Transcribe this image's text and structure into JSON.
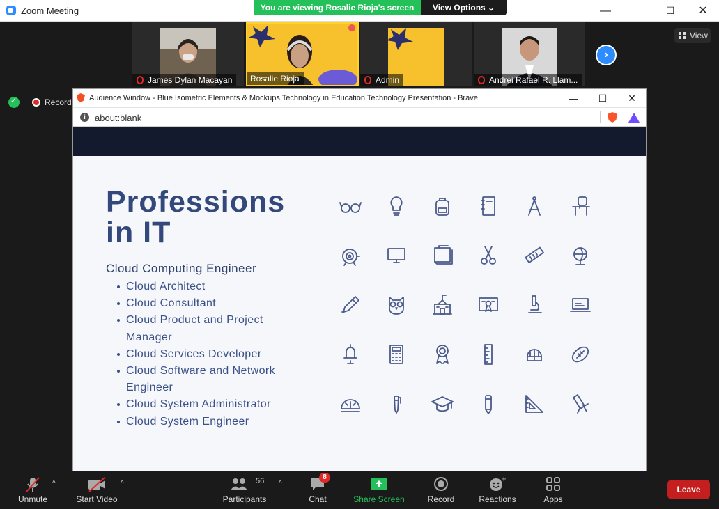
{
  "window": {
    "title": "Zoom Meeting",
    "minimize": "—",
    "maximize": "☐",
    "close": "✕"
  },
  "banner": {
    "message": "You are viewing Rosalie Rioja's screen",
    "view_options": "View Options ⌄"
  },
  "participants_strip": [
    {
      "name": "James Dylan Macayan",
      "muted": true
    },
    {
      "name": "Rosalie Rioja",
      "muted": false
    },
    {
      "name": "Admin",
      "muted": true
    },
    {
      "name": "Andrei Rafael R. Llam...",
      "muted": true
    }
  ],
  "view_button": "View",
  "recording_label": "Recording",
  "browser": {
    "title": "Audience Window - Blue Isometric Elements & Mockups Technology in Education Technology Presentation - Brave",
    "address": "about:blank",
    "info_glyph": "i",
    "minimize": "—",
    "maximize": "☐",
    "close": "✕"
  },
  "slide": {
    "title_line1": "Professions",
    "title_line2": "in IT",
    "subheading": "Cloud Computing Engineer",
    "items": [
      "Cloud Architect",
      "Cloud Consultant",
      "Cloud Product and Project Manager",
      "Cloud Services Developer",
      "Cloud Software and Network Engineer",
      "Cloud System Administrator",
      "Cloud System Engineer"
    ],
    "icon_color": "#4a5a8a",
    "icons": [
      "glasses-icon",
      "lightbulb-icon",
      "backpack-icon",
      "notebook-icon",
      "compass-icon",
      "school-desk-icon",
      "alarm-bell-icon",
      "monitor-icon",
      "book-icon",
      "scissors-icon",
      "ruler-icon",
      "globe-icon",
      "pencil-icon",
      "owl-icon",
      "school-building-icon",
      "certificate-icon",
      "microscope-icon",
      "laptop-icon",
      "school-bell-icon",
      "calculator-icon",
      "award-icon",
      "ruler-vertical-icon",
      "helmet-icon",
      "football-icon",
      "protractor-icon",
      "pen-icon",
      "graduation-cap-icon",
      "pencil-vertical-icon",
      "set-square-icon",
      "telescope-icon"
    ]
  },
  "toolbar": {
    "unmute": "Unmute",
    "start_video": "Start Video",
    "participants": "Participants",
    "participants_count": "56",
    "chat": "Chat",
    "chat_badge": "8",
    "share_screen": "Share Screen",
    "record": "Record",
    "reactions": "Reactions",
    "apps": "Apps",
    "leave": "Leave",
    "caret": "^",
    "share_color": "#24c05a",
    "leave_color": "#c41e1e"
  }
}
